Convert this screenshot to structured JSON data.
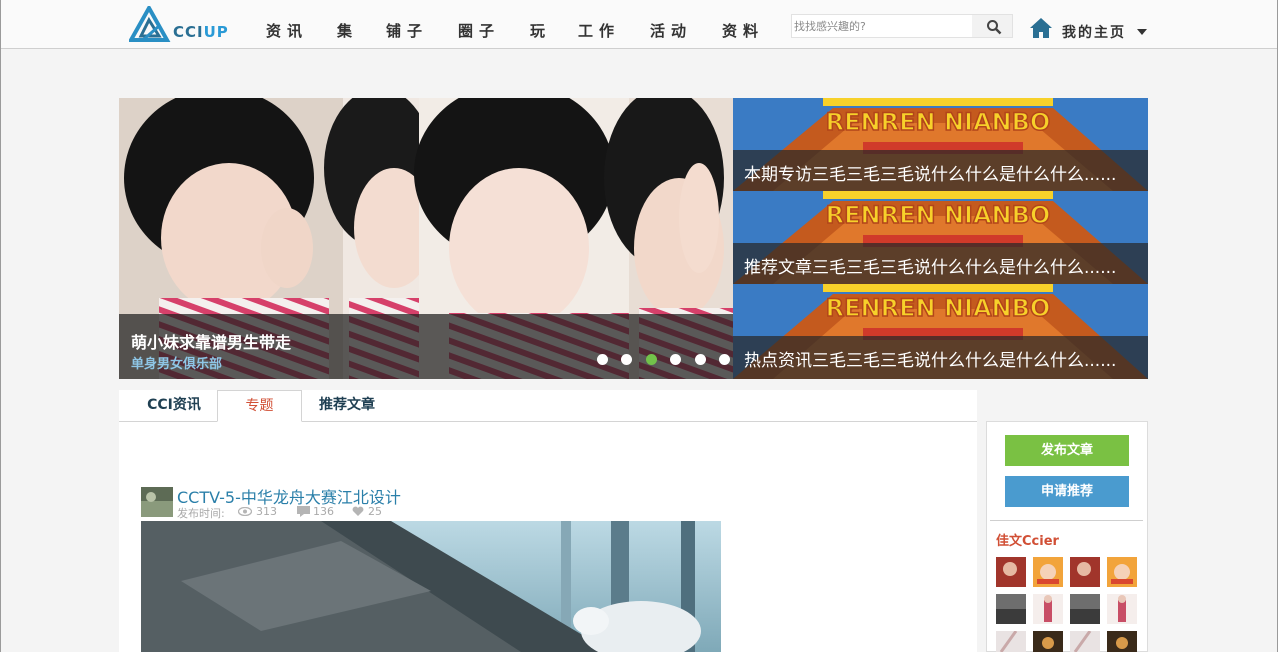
{
  "header": {
    "logo_text_a": "CCI",
    "logo_text_b": "UP",
    "nav": [
      "资讯",
      "集",
      "铺子",
      "圈子",
      "玩",
      "工作",
      "活动",
      "资料"
    ],
    "search_placeholder": "找找感兴趣的?",
    "my_home": "我的主页"
  },
  "banner": {
    "caption_title": "萌小妹求靠谱男生带走",
    "caption_sub": "单身男女俱乐部",
    "dots": 6,
    "active_dot": 3
  },
  "promos": {
    "logo_text": "RENREN NIANBO",
    "items": [
      "本期专访三毛三毛三毛说什么什么是什么什么......",
      "推荐文章三毛三毛三毛说什么什么是什么什么......",
      "热点资讯三毛三毛三毛说什么什么是什么什么......"
    ]
  },
  "tabs": [
    "CCI资讯",
    "专题",
    "推荐文章"
  ],
  "active_tab": "专题",
  "article": {
    "title": "CCTV-5-中华龙舟大赛江北设计",
    "date_label": "发布时间:",
    "views": "313",
    "comments": "136",
    "likes": "25"
  },
  "sidebar": {
    "post_button": "发布文章",
    "apply_button": "申请推荐",
    "section_title": "佳文Ccier"
  },
  "colors": {
    "accent_green": "#7ac143",
    "accent_blue": "#4a9bcf",
    "accent_red": "#d14f35",
    "link_blue": "#2a7fa9"
  }
}
